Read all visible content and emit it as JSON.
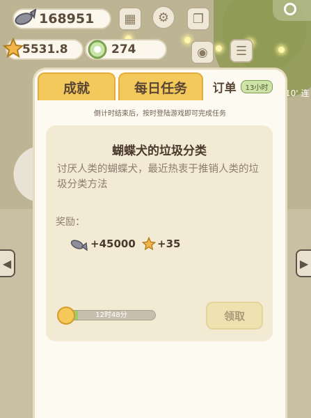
{
  "resources": {
    "fish_count": "168951",
    "star_value": "5531.8",
    "coin_count": "274"
  },
  "tabs": [
    {
      "label": "成就"
    },
    {
      "label": "每日任务"
    },
    {
      "label": "订单",
      "badge": "13小时"
    }
  ],
  "hint": "倒计时结束后，按时登陆游戏即可完成任务",
  "order": {
    "title": "蝴蝶犬的垃圾分类",
    "description": "讨厌人类的蝴蝶犬，最近热衷于推销人类的垃圾分类方法",
    "reward_label": "奖励：",
    "reward_fish": "+45000",
    "reward_star": "+35",
    "timer_text": "12时48分",
    "timer_progress": 0.12,
    "claim_label": "领取"
  },
  "side_text": "10' 连",
  "colors": {
    "tab_inactive": "#f4c95b",
    "panel_bg": "#fdfaf1",
    "card_bg": "#f3ead4",
    "timer_fill": "#9ccc6a"
  }
}
